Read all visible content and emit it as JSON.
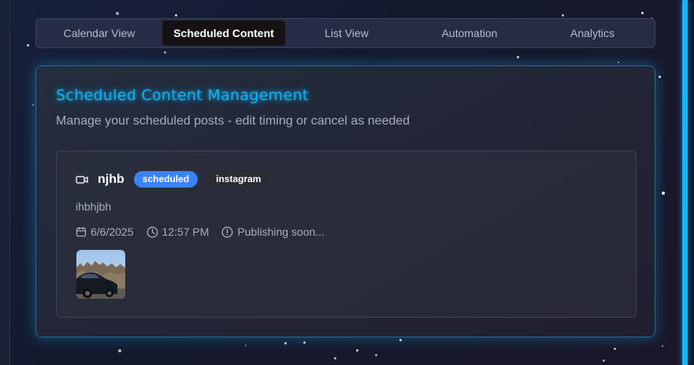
{
  "tabs": [
    {
      "label": "Calendar View",
      "active": false
    },
    {
      "label": "Scheduled Content",
      "active": true
    },
    {
      "label": "List View",
      "active": false
    },
    {
      "label": "Automation",
      "active": false
    },
    {
      "label": "Analytics",
      "active": false
    }
  ],
  "panel": {
    "title": "Scheduled Content Management",
    "subtitle": "Manage your scheduled posts - edit timing or cancel as needed"
  },
  "post": {
    "title": "njhb",
    "status": "scheduled",
    "platform": "instagram",
    "description": "ihbhjbh",
    "date": "6/6/2025",
    "time": "12:57 PM",
    "publish_status": "Publishing soon...",
    "media_icon": "video-icon"
  },
  "colors": {
    "accent": "#15b0f0",
    "status_badge": "#3b82f6",
    "platform_badge": "#2b2c33"
  }
}
